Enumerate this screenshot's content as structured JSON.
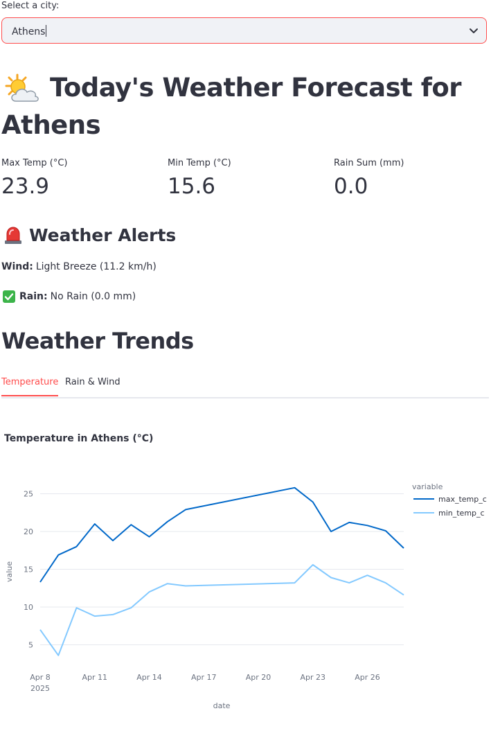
{
  "city_select": {
    "label": "Select a city:",
    "value": "Athens"
  },
  "header": {
    "title": "Today's Weather Forecast for Athens",
    "icon": "sun-behind-cloud-icon"
  },
  "metrics": [
    {
      "label": "Max Temp (°C)",
      "value": "23.9"
    },
    {
      "label": "Min Temp (°C)",
      "value": "15.6"
    },
    {
      "label": "Rain Sum (mm)",
      "value": "0.0"
    }
  ],
  "alerts": {
    "heading": "Weather Alerts",
    "icon": "siren-icon",
    "wind_label": "Wind:",
    "wind_text": "Light Breeze (11.2 km/h)",
    "rain_icon": "check-mark-icon",
    "rain_label": "Rain:",
    "rain_text": "No Rain (0.0 mm)"
  },
  "trends": {
    "heading": "Weather Trends",
    "tabs": [
      {
        "label": "Temperature",
        "active": true
      },
      {
        "label": "Rain & Wind",
        "active": false
      }
    ]
  },
  "colors": {
    "accent": "#ff4b4b",
    "max_line": "#0068c9",
    "min_line": "#83c9ff"
  },
  "chart_data": {
    "type": "line",
    "title": "Temperature in Athens (°C)",
    "xlabel": "date",
    "ylabel": "value",
    "legend_title": "variable",
    "legend_position": "right",
    "x_ticks": [
      "Apr 8",
      "Apr 11",
      "Apr 14",
      "Apr 17",
      "Apr 20",
      "Apr 23",
      "Apr 26"
    ],
    "x_year": "2025",
    "y_ticks": [
      5,
      10,
      15,
      20,
      25
    ],
    "ylim": [
      2.5,
      26.5
    ],
    "x": [
      "2025-04-08",
      "2025-04-09",
      "2025-04-10",
      "2025-04-11",
      "2025-04-12",
      "2025-04-13",
      "2025-04-14",
      "2025-04-15",
      "2025-04-16",
      "2025-04-22",
      "2025-04-23",
      "2025-04-24",
      "2025-04-25",
      "2025-04-26",
      "2025-04-27",
      "2025-04-28"
    ],
    "series": [
      {
        "name": "max_temp_c",
        "values": [
          13.3,
          16.9,
          18.0,
          21.0,
          18.8,
          20.9,
          19.3,
          21.3,
          22.9,
          25.8,
          23.9,
          20.0,
          21.2,
          20.8,
          20.1,
          17.8
        ]
      },
      {
        "name": "min_temp_c",
        "values": [
          7.0,
          3.6,
          9.9,
          8.8,
          9.0,
          9.9,
          12.0,
          13.1,
          12.8,
          13.2,
          15.6,
          13.9,
          13.2,
          14.2,
          13.2,
          11.6
        ]
      }
    ],
    "grid": true
  }
}
